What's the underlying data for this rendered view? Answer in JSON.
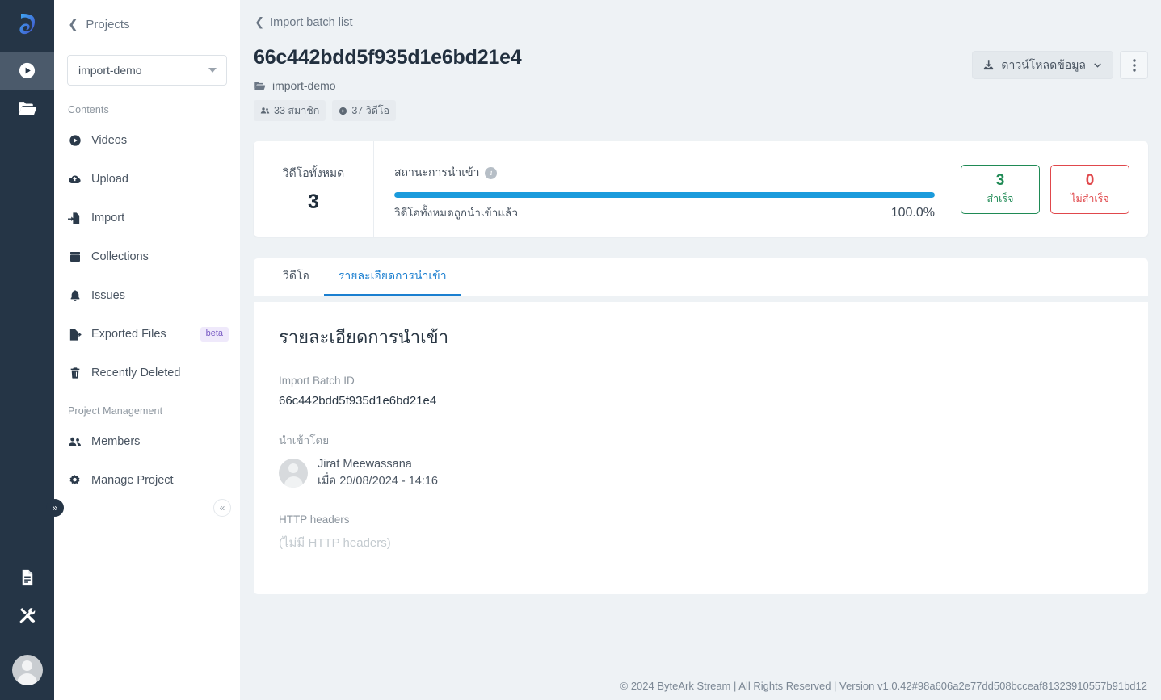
{
  "rail": {
    "logo_icon": "byteark-logo-icon",
    "items": [
      {
        "name": "videos-rail",
        "icon": "play-circle-icon",
        "active": true
      },
      {
        "name": "projects-rail",
        "icon": "folder-open-icon",
        "active": false
      },
      {
        "name": "docs-rail",
        "icon": "document-icon",
        "active": false
      },
      {
        "name": "tools-rail",
        "icon": "tools-icon",
        "active": false
      }
    ],
    "avatar_icon": "user-avatar-icon"
  },
  "sidebar": {
    "back_label": "Projects",
    "back_icon": "chevron-left-icon",
    "project_select": {
      "value": "import-demo",
      "caret_icon": "caret-down-icon"
    },
    "groups": [
      {
        "title": "Contents",
        "items": [
          {
            "label": "Videos",
            "icon": "play-circle-icon"
          },
          {
            "label": "Upload",
            "icon": "cloud-upload-icon"
          },
          {
            "label": "Import",
            "icon": "file-import-icon"
          },
          {
            "label": "Collections",
            "icon": "collections-icon"
          },
          {
            "label": "Issues",
            "icon": "bell-icon"
          },
          {
            "label": "Exported Files",
            "icon": "file-export-icon",
            "badge": "beta"
          },
          {
            "label": "Recently Deleted",
            "icon": "trash-icon"
          }
        ]
      },
      {
        "title": "Project Management",
        "items": [
          {
            "label": "Members",
            "icon": "users-icon"
          },
          {
            "label": "Manage Project",
            "icon": "gear-icon"
          }
        ]
      }
    ],
    "collapse_icon": "chevrons-left-icon",
    "expander_icon": "chevrons-right-icon"
  },
  "main": {
    "breadcrumb": {
      "label": "Import batch list",
      "icon": "chevron-left-icon"
    },
    "page_title": "66c442bdd5f935d1e6bd21e4",
    "project": {
      "icon": "folder-icon",
      "name": "import-demo"
    },
    "meta_chips": [
      {
        "icon": "users-icon",
        "label": "33 สมาชิก"
      },
      {
        "icon": "video-circle-icon",
        "label": "37 วิดีโอ"
      }
    ],
    "actions": {
      "download_label": "ดาวน์โหลดข้อมูล",
      "download_icon": "download-icon",
      "download_caret_icon": "chevron-down-icon",
      "kebab_icon": "kebab-menu-icon"
    },
    "status_card": {
      "total_label": "วิดีโอทั้งหมด",
      "total_value": "3",
      "status_label": "สถานะการนำเข้า",
      "info_icon": "info-icon",
      "progress_percent_text": "100.0%",
      "progress_percent": 100,
      "progress_note": "วิดีโอทั้งหมดถูกนำเข้าแล้ว",
      "stats": [
        {
          "value": "3",
          "label": "สำเร็จ",
          "color": "#1f8a55",
          "name": "success"
        },
        {
          "value": "0",
          "label": "ไม่สำเร็จ",
          "color": "#e0484c",
          "name": "failed"
        }
      ]
    },
    "tabs": [
      {
        "label": "วิดีโอ",
        "active": false
      },
      {
        "label": "รายละเอียดการนำเข้า",
        "active": true
      }
    ],
    "panel": {
      "title": "รายละเอียดการนำเข้า",
      "batch_id_label": "Import Batch ID",
      "batch_id_value": "66c442bdd5f935d1e6bd21e4",
      "imported_by_label": "นำเข้าโดย",
      "imported_by_name": "Jirat Meewassana",
      "imported_by_date": "เมื่อ 20/08/2024 - 14:16",
      "http_headers_label": "HTTP headers",
      "http_headers_value": "(ไม่มี HTTP headers)"
    },
    "footer": "© 2024 ByteArk Stream | All Rights Reserved | Version v1.0.42#98a606a2e77dd508bcceaf81323910557b91bd12"
  },
  "colors": {
    "accent": "#1b7fd0",
    "progress": "#1b9bdc",
    "rail_bg": "#253546",
    "page_bg": "#eef2f5"
  }
}
